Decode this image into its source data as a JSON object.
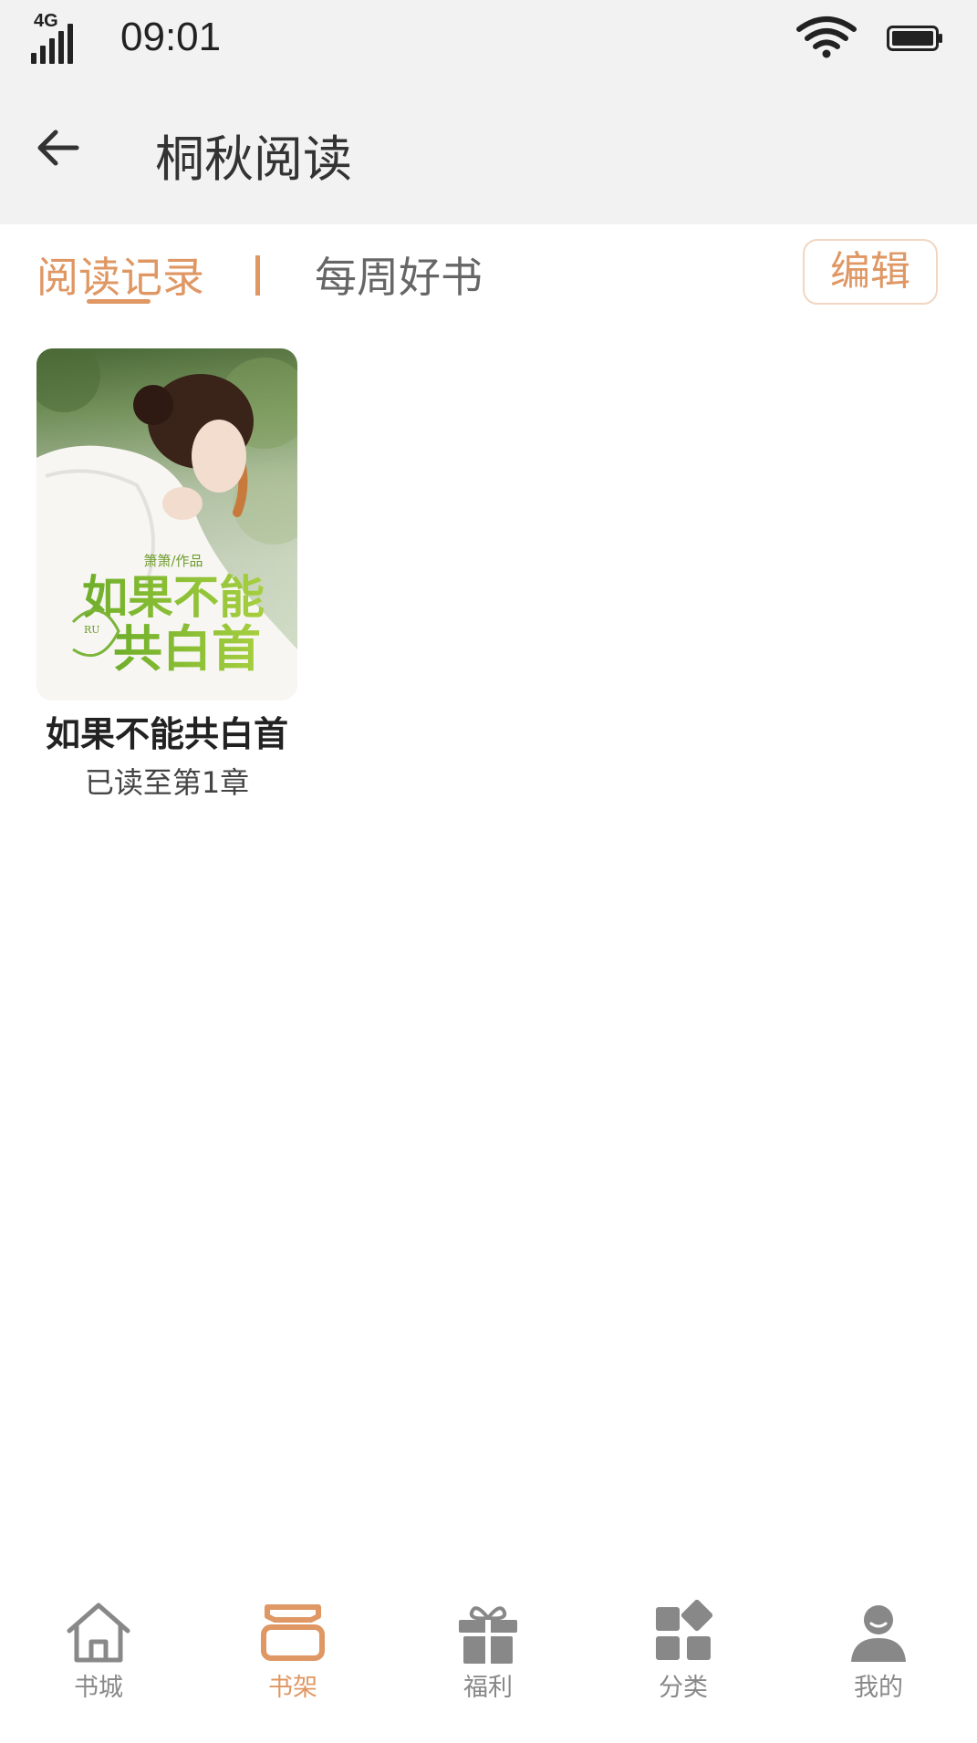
{
  "status_bar": {
    "network": "4G",
    "time": "09:01"
  },
  "header": {
    "title": "桐秋阅读",
    "back_icon": "arrow-left-icon"
  },
  "tabs": [
    {
      "label": "阅读记录",
      "active": true
    },
    {
      "label": "每周好书",
      "active": false
    }
  ],
  "toolbar": {
    "edit_label": "编辑"
  },
  "books": [
    {
      "title": "如果不能共白首",
      "progress": "已读至第1章"
    }
  ],
  "bottom_nav": [
    {
      "label": "书城",
      "icon": "home-icon",
      "active": false
    },
    {
      "label": "书架",
      "icon": "bookshelf-icon",
      "active": true
    },
    {
      "label": "福利",
      "icon": "gift-icon",
      "active": false
    },
    {
      "label": "分类",
      "icon": "category-icon",
      "active": false
    },
    {
      "label": "我的",
      "icon": "profile-icon",
      "active": false
    }
  ],
  "colors": {
    "accent": "#df9763",
    "header_bg": "#f2f2f2",
    "inactive_text": "#666666",
    "nav_icon": "#888888"
  }
}
